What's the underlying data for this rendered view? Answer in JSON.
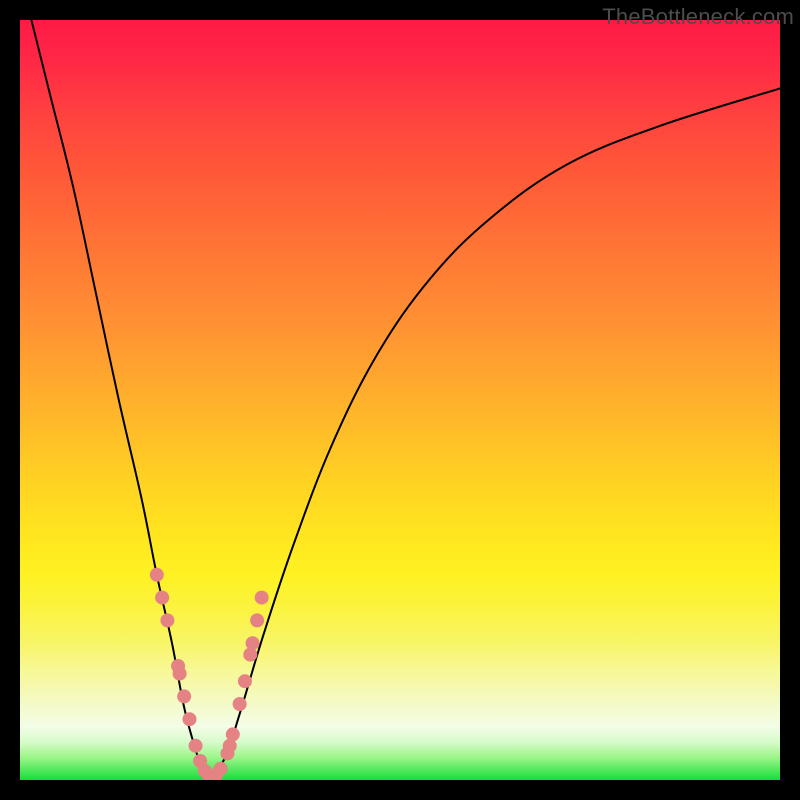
{
  "watermark": "TheBottleneck.com",
  "colors": {
    "frame": "#000000",
    "curve": "#000000",
    "marker_fill": "#e58384",
    "marker_stroke": "#e58384"
  },
  "chart_data": {
    "type": "line",
    "title": "",
    "xlabel": "",
    "ylabel": "",
    "xlim": [
      0,
      100
    ],
    "ylim": [
      0,
      100
    ],
    "grid": false,
    "legend": false,
    "note": "Bottleneck percentage curve. X is relative hardware tier (left→right). Y is bottleneck %; minimum ≈ 0% near x≈25. No numeric axis labels are visible; values are estimates from plot geometry.",
    "series": [
      {
        "name": "curve-left",
        "style": "line",
        "x": [
          1.5,
          4,
          7,
          10,
          13,
          16,
          18,
          20,
          21.5,
          22.8,
          23.8,
          25
        ],
        "y": [
          100,
          90,
          78,
          64,
          50,
          37,
          27,
          18,
          10,
          5,
          2,
          0
        ]
      },
      {
        "name": "curve-right",
        "style": "line",
        "x": [
          25,
          27,
          29,
          32,
          36,
          41,
          47,
          54,
          62,
          72,
          84,
          100
        ],
        "y": [
          0,
          3,
          9,
          19,
          31,
          44,
          56,
          66,
          74,
          81,
          86,
          91
        ]
      },
      {
        "name": "dot-cluster",
        "style": "scatter",
        "note": "Salient points highlighted along the curve near the trough.",
        "x": [
          18.0,
          18.7,
          19.4,
          20.8,
          21.0,
          21.6,
          22.3,
          23.1,
          23.7,
          24.3,
          24.9,
          25.8,
          26.4,
          27.3,
          27.6,
          28.0,
          28.9,
          29.6,
          30.3,
          30.6,
          31.2,
          31.8
        ],
        "y": [
          27.0,
          24.0,
          21.0,
          15.0,
          14.0,
          11.0,
          8.0,
          4.5,
          2.5,
          1.2,
          0.5,
          0.7,
          1.5,
          3.5,
          4.5,
          6.0,
          10.0,
          13.0,
          16.5,
          18.0,
          21.0,
          24.0
        ]
      }
    ]
  }
}
